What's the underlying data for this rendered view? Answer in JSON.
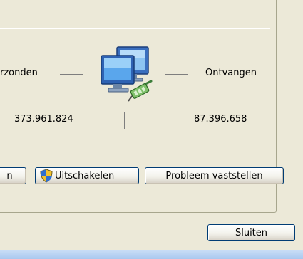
{
  "activity": {
    "sent_label": "rzonden",
    "received_label": "Ontvangen",
    "sent_value": "373.961.824",
    "received_value": "87.396.658"
  },
  "buttons": {
    "properties_label": "n",
    "disable_label": "Uitschakelen",
    "diagnose_label": "Probleem vaststellen",
    "close_label": "Sluiten"
  },
  "icons": {
    "network": "network-computers-icon",
    "shield": "uac-shield-icon"
  }
}
